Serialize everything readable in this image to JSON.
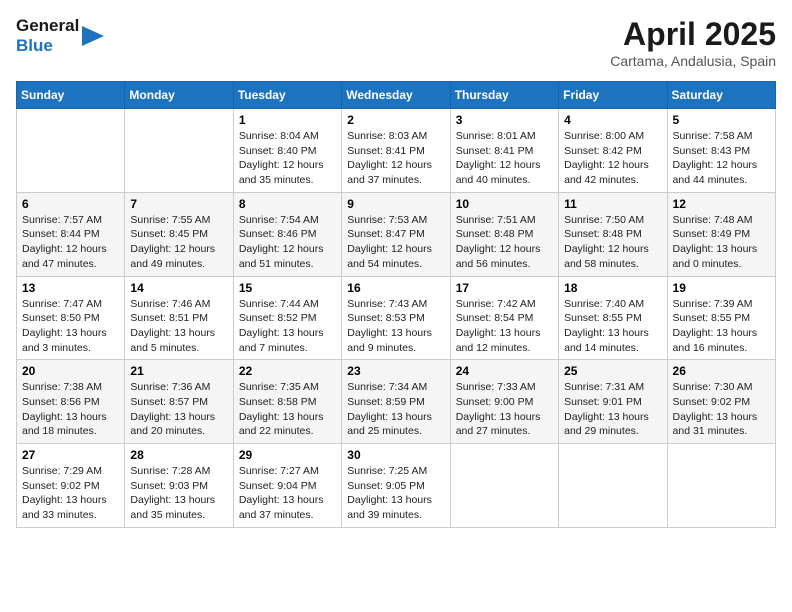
{
  "logo": {
    "line1": "General",
    "line2": "Blue"
  },
  "title": "April 2025",
  "subtitle": "Cartama, Andalusia, Spain",
  "weekdays": [
    "Sunday",
    "Monday",
    "Tuesday",
    "Wednesday",
    "Thursday",
    "Friday",
    "Saturday"
  ],
  "weeks": [
    [
      {
        "day": "",
        "sunrise": "",
        "sunset": "",
        "daylight": ""
      },
      {
        "day": "",
        "sunrise": "",
        "sunset": "",
        "daylight": ""
      },
      {
        "day": "1",
        "sunrise": "Sunrise: 8:04 AM",
        "sunset": "Sunset: 8:40 PM",
        "daylight": "Daylight: 12 hours and 35 minutes."
      },
      {
        "day": "2",
        "sunrise": "Sunrise: 8:03 AM",
        "sunset": "Sunset: 8:41 PM",
        "daylight": "Daylight: 12 hours and 37 minutes."
      },
      {
        "day": "3",
        "sunrise": "Sunrise: 8:01 AM",
        "sunset": "Sunset: 8:41 PM",
        "daylight": "Daylight: 12 hours and 40 minutes."
      },
      {
        "day": "4",
        "sunrise": "Sunrise: 8:00 AM",
        "sunset": "Sunset: 8:42 PM",
        "daylight": "Daylight: 12 hours and 42 minutes."
      },
      {
        "day": "5",
        "sunrise": "Sunrise: 7:58 AM",
        "sunset": "Sunset: 8:43 PM",
        "daylight": "Daylight: 12 hours and 44 minutes."
      }
    ],
    [
      {
        "day": "6",
        "sunrise": "Sunrise: 7:57 AM",
        "sunset": "Sunset: 8:44 PM",
        "daylight": "Daylight: 12 hours and 47 minutes."
      },
      {
        "day": "7",
        "sunrise": "Sunrise: 7:55 AM",
        "sunset": "Sunset: 8:45 PM",
        "daylight": "Daylight: 12 hours and 49 minutes."
      },
      {
        "day": "8",
        "sunrise": "Sunrise: 7:54 AM",
        "sunset": "Sunset: 8:46 PM",
        "daylight": "Daylight: 12 hours and 51 minutes."
      },
      {
        "day": "9",
        "sunrise": "Sunrise: 7:53 AM",
        "sunset": "Sunset: 8:47 PM",
        "daylight": "Daylight: 12 hours and 54 minutes."
      },
      {
        "day": "10",
        "sunrise": "Sunrise: 7:51 AM",
        "sunset": "Sunset: 8:48 PM",
        "daylight": "Daylight: 12 hours and 56 minutes."
      },
      {
        "day": "11",
        "sunrise": "Sunrise: 7:50 AM",
        "sunset": "Sunset: 8:48 PM",
        "daylight": "Daylight: 12 hours and 58 minutes."
      },
      {
        "day": "12",
        "sunrise": "Sunrise: 7:48 AM",
        "sunset": "Sunset: 8:49 PM",
        "daylight": "Daylight: 13 hours and 0 minutes."
      }
    ],
    [
      {
        "day": "13",
        "sunrise": "Sunrise: 7:47 AM",
        "sunset": "Sunset: 8:50 PM",
        "daylight": "Daylight: 13 hours and 3 minutes."
      },
      {
        "day": "14",
        "sunrise": "Sunrise: 7:46 AM",
        "sunset": "Sunset: 8:51 PM",
        "daylight": "Daylight: 13 hours and 5 minutes."
      },
      {
        "day": "15",
        "sunrise": "Sunrise: 7:44 AM",
        "sunset": "Sunset: 8:52 PM",
        "daylight": "Daylight: 13 hours and 7 minutes."
      },
      {
        "day": "16",
        "sunrise": "Sunrise: 7:43 AM",
        "sunset": "Sunset: 8:53 PM",
        "daylight": "Daylight: 13 hours and 9 minutes."
      },
      {
        "day": "17",
        "sunrise": "Sunrise: 7:42 AM",
        "sunset": "Sunset: 8:54 PM",
        "daylight": "Daylight: 13 hours and 12 minutes."
      },
      {
        "day": "18",
        "sunrise": "Sunrise: 7:40 AM",
        "sunset": "Sunset: 8:55 PM",
        "daylight": "Daylight: 13 hours and 14 minutes."
      },
      {
        "day": "19",
        "sunrise": "Sunrise: 7:39 AM",
        "sunset": "Sunset: 8:55 PM",
        "daylight": "Daylight: 13 hours and 16 minutes."
      }
    ],
    [
      {
        "day": "20",
        "sunrise": "Sunrise: 7:38 AM",
        "sunset": "Sunset: 8:56 PM",
        "daylight": "Daylight: 13 hours and 18 minutes."
      },
      {
        "day": "21",
        "sunrise": "Sunrise: 7:36 AM",
        "sunset": "Sunset: 8:57 PM",
        "daylight": "Daylight: 13 hours and 20 minutes."
      },
      {
        "day": "22",
        "sunrise": "Sunrise: 7:35 AM",
        "sunset": "Sunset: 8:58 PM",
        "daylight": "Daylight: 13 hours and 22 minutes."
      },
      {
        "day": "23",
        "sunrise": "Sunrise: 7:34 AM",
        "sunset": "Sunset: 8:59 PM",
        "daylight": "Daylight: 13 hours and 25 minutes."
      },
      {
        "day": "24",
        "sunrise": "Sunrise: 7:33 AM",
        "sunset": "Sunset: 9:00 PM",
        "daylight": "Daylight: 13 hours and 27 minutes."
      },
      {
        "day": "25",
        "sunrise": "Sunrise: 7:31 AM",
        "sunset": "Sunset: 9:01 PM",
        "daylight": "Daylight: 13 hours and 29 minutes."
      },
      {
        "day": "26",
        "sunrise": "Sunrise: 7:30 AM",
        "sunset": "Sunset: 9:02 PM",
        "daylight": "Daylight: 13 hours and 31 minutes."
      }
    ],
    [
      {
        "day": "27",
        "sunrise": "Sunrise: 7:29 AM",
        "sunset": "Sunset: 9:02 PM",
        "daylight": "Daylight: 13 hours and 33 minutes."
      },
      {
        "day": "28",
        "sunrise": "Sunrise: 7:28 AM",
        "sunset": "Sunset: 9:03 PM",
        "daylight": "Daylight: 13 hours and 35 minutes."
      },
      {
        "day": "29",
        "sunrise": "Sunrise: 7:27 AM",
        "sunset": "Sunset: 9:04 PM",
        "daylight": "Daylight: 13 hours and 37 minutes."
      },
      {
        "day": "30",
        "sunrise": "Sunrise: 7:25 AM",
        "sunset": "Sunset: 9:05 PM",
        "daylight": "Daylight: 13 hours and 39 minutes."
      },
      {
        "day": "",
        "sunrise": "",
        "sunset": "",
        "daylight": ""
      },
      {
        "day": "",
        "sunrise": "",
        "sunset": "",
        "daylight": ""
      },
      {
        "day": "",
        "sunrise": "",
        "sunset": "",
        "daylight": ""
      }
    ]
  ]
}
